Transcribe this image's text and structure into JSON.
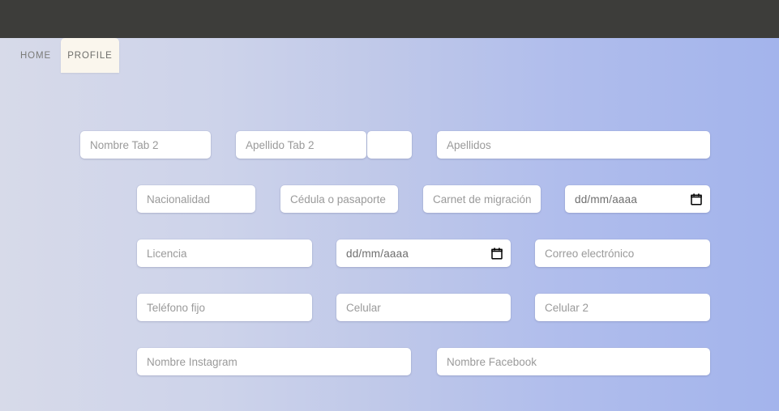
{
  "window": {
    "header_bar_color": "#3d3d3a",
    "background_gradient_from": "#d7dae9",
    "background_gradient_to": "#a3b4ec"
  },
  "tabs": [
    {
      "id": "home",
      "label": "HOME",
      "active": false
    },
    {
      "id": "profile",
      "label": "PROFILE",
      "active": true,
      "active_bg": "#faf6ed"
    }
  ],
  "form": {
    "rows": [
      {
        "fields": [
          {
            "name": "nombre-tab-2",
            "placeholder": "Nombre Tab 2",
            "value": "",
            "type": "text"
          },
          {
            "name": "apellido-tab-2",
            "placeholder": "Apellido Tab 2",
            "value": "",
            "type": "text"
          },
          {
            "name": "unlabeled",
            "placeholder": "",
            "value": "",
            "type": "text"
          },
          {
            "name": "apellidos",
            "placeholder": "Apellidos",
            "value": "",
            "type": "text"
          }
        ]
      },
      {
        "fields": [
          {
            "name": "nacionalidad",
            "placeholder": "Nacionalidad",
            "value": "",
            "type": "text"
          },
          {
            "name": "cedula-o-pasaporte",
            "placeholder": "Cédula o pasaporte",
            "value": "",
            "type": "text"
          },
          {
            "name": "carnet-de-migracion",
            "placeholder": "Carnet de migración",
            "value": "",
            "type": "text"
          },
          {
            "name": "fecha-nacimiento",
            "placeholder": "dd/mm/aaaa",
            "value": "",
            "type": "date"
          }
        ]
      },
      {
        "fields": [
          {
            "name": "licencia",
            "placeholder": "Licencia",
            "value": "",
            "type": "text"
          },
          {
            "name": "fecha-licencia",
            "placeholder": "dd/mm/aaaa",
            "value": "",
            "type": "date"
          },
          {
            "name": "correo-electronico",
            "placeholder": "Correo electrónico",
            "value": "",
            "type": "text"
          }
        ]
      },
      {
        "fields": [
          {
            "name": "telefono-fijo",
            "placeholder": "Teléfono fijo",
            "value": "",
            "type": "text"
          },
          {
            "name": "celular",
            "placeholder": "Celular",
            "value": "",
            "type": "text"
          },
          {
            "name": "celular-2",
            "placeholder": "Celular 2",
            "value": "",
            "type": "text"
          }
        ]
      },
      {
        "fields": [
          {
            "name": "nombre-instagram",
            "placeholder": "Nombre Instagram",
            "value": "",
            "type": "text"
          },
          {
            "name": "nombre-facebook",
            "placeholder": "Nombre Facebook",
            "value": "",
            "type": "text"
          }
        ]
      }
    ]
  },
  "icons": {
    "calendar": "calendar-icon"
  }
}
